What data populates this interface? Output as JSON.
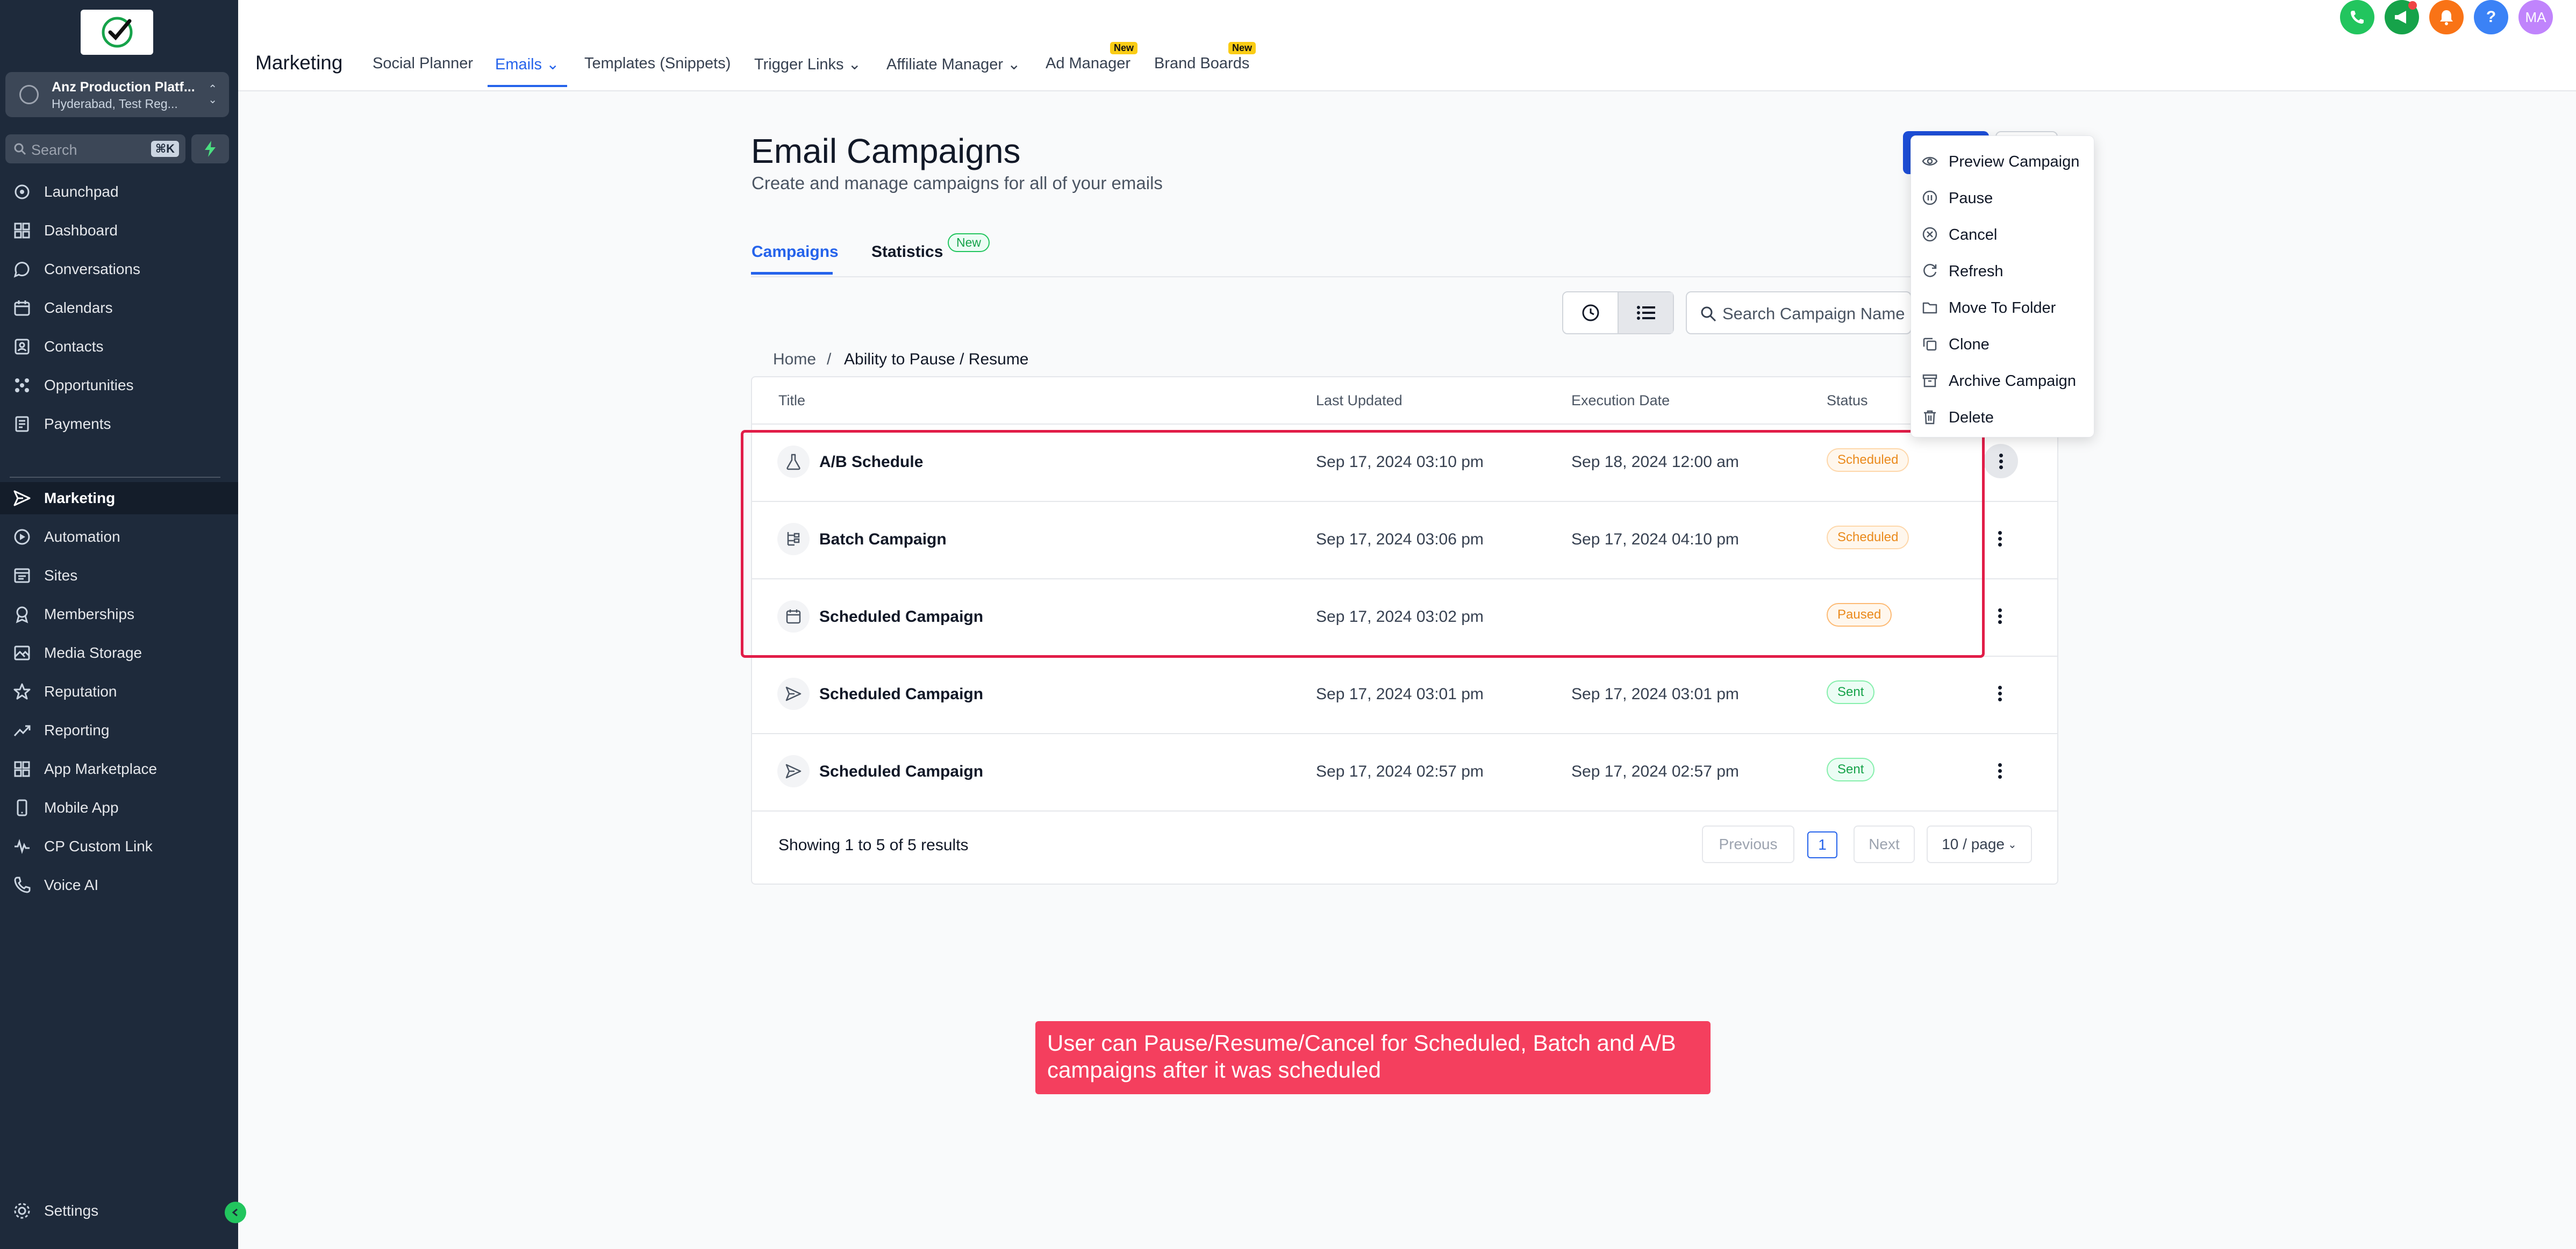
{
  "sidebar": {
    "account": {
      "name": "Anz Production Platf...",
      "location": "Hyderabad, Test Reg..."
    },
    "search": {
      "placeholder": "Search",
      "shortcut": "⌘K"
    },
    "items": [
      {
        "label": "Launchpad",
        "icon": "launchpad-icon"
      },
      {
        "label": "Dashboard",
        "icon": "dashboard-icon"
      },
      {
        "label": "Conversations",
        "icon": "chat-icon"
      },
      {
        "label": "Calendars",
        "icon": "calendar-icon"
      },
      {
        "label": "Contacts",
        "icon": "contacts-icon"
      },
      {
        "label": "Opportunities",
        "icon": "opportunities-icon"
      },
      {
        "label": "Payments",
        "icon": "payments-icon"
      },
      {
        "label": "Marketing",
        "icon": "send-icon",
        "active": true
      },
      {
        "label": "Automation",
        "icon": "automation-icon"
      },
      {
        "label": "Sites",
        "icon": "sites-icon"
      },
      {
        "label": "Memberships",
        "icon": "memberships-icon"
      },
      {
        "label": "Media Storage",
        "icon": "image-icon"
      },
      {
        "label": "Reputation",
        "icon": "star-icon"
      },
      {
        "label": "Reporting",
        "icon": "trend-icon"
      },
      {
        "label": "App Marketplace",
        "icon": "apps-icon"
      },
      {
        "label": "Mobile App",
        "icon": "mobile-icon"
      },
      {
        "label": "CP Custom Link",
        "icon": "link-icon"
      },
      {
        "label": "Voice AI",
        "icon": "phone-icon"
      }
    ],
    "settings": "Settings"
  },
  "topbar": {
    "title": "Marketing",
    "links": [
      {
        "label": "Social Planner"
      },
      {
        "label": "Emails",
        "active": true,
        "dropdown": true
      },
      {
        "label": "Templates (Snippets)"
      },
      {
        "label": "Trigger Links",
        "dropdown": true
      },
      {
        "label": "Affiliate Manager",
        "dropdown": true
      },
      {
        "label": "Ad Manager",
        "badge": "New"
      },
      {
        "label": "Brand Boards",
        "badge": "New"
      }
    ],
    "avatar": "MA"
  },
  "page": {
    "title": "Email Campaigns",
    "subtitle": "Create and manage campaigns for all of your emails",
    "tabs": [
      {
        "label": "Campaigns",
        "active": true
      },
      {
        "label": "Statistics",
        "badge": "New"
      }
    ],
    "search_placeholder": "Search Campaign Name",
    "breadcrumb": [
      "Home",
      "/",
      "Ability to Pause / Resume"
    ]
  },
  "table": {
    "columns": [
      "Title",
      "Last Updated",
      "Execution Date",
      "Status"
    ],
    "rows": [
      {
        "title": "A/B Schedule",
        "icon": "flask-icon",
        "updated": "Sep 17, 2024 03:10 pm",
        "execution": "Sep 18, 2024 12:00 am",
        "status": "Scheduled"
      },
      {
        "title": "Batch Campaign",
        "icon": "batch-icon",
        "updated": "Sep 17, 2024 03:06 pm",
        "execution": "Sep 17, 2024 04:10 pm",
        "status": "Scheduled"
      },
      {
        "title": "Scheduled Campaign",
        "icon": "calendar-icon",
        "updated": "Sep 17, 2024 03:02 pm",
        "execution": "",
        "status": "Paused"
      },
      {
        "title": "Scheduled Campaign",
        "icon": "send-icon",
        "updated": "Sep 17, 2024 03:01 pm",
        "execution": "Sep 17, 2024 03:01 pm",
        "status": "Sent"
      },
      {
        "title": "Scheduled Campaign",
        "icon": "send-icon",
        "updated": "Sep 17, 2024 02:57 pm",
        "execution": "Sep 17, 2024 02:57 pm",
        "status": "Sent"
      }
    ],
    "footer": "Showing 1 to 5 of 5 results",
    "pagination": {
      "previous": "Previous",
      "current": "1",
      "next": "Next",
      "per_page": "10 / page"
    }
  },
  "menu": {
    "items": [
      {
        "label": "Preview Campaign",
        "icon": "eye-icon"
      },
      {
        "label": "Pause",
        "icon": "pause-icon"
      },
      {
        "label": "Cancel",
        "icon": "cancel-icon"
      },
      {
        "label": "Refresh",
        "icon": "refresh-icon"
      },
      {
        "label": "Move To Folder",
        "icon": "folder-icon"
      },
      {
        "label": "Clone",
        "icon": "clone-icon"
      },
      {
        "label": "Archive Campaign",
        "icon": "archive-icon"
      },
      {
        "label": "Delete",
        "icon": "trash-icon"
      }
    ]
  },
  "callout": "User can Pause/Resume/Cancel for Scheduled, Batch and A/B campaigns after it was scheduled",
  "colors": {
    "accent": "#2563eb",
    "sidebar": "#1e2a3b",
    "highlight": "#e11d48",
    "callout": "#f43f5e"
  }
}
